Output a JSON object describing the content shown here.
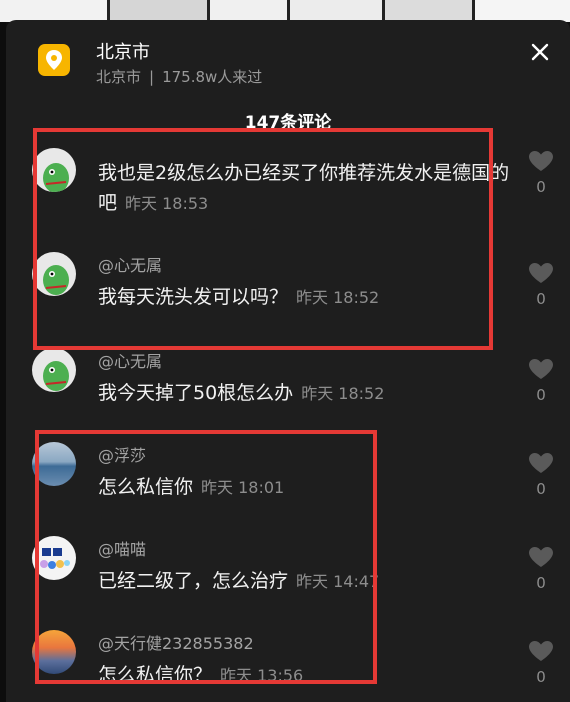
{
  "location": {
    "title": "北京市",
    "city": "北京市",
    "separator": "|",
    "visitors": "175.8w人来过",
    "icon": "location-pin-icon"
  },
  "comments_header": "147条评论",
  "comments": [
    {
      "author": "",
      "text": "我也是2级怎么办已经买了你推荐洗发水是德国的吧",
      "time": "昨天 18:53",
      "likes": "0"
    },
    {
      "author": "@心无属",
      "text": "我每天洗头发可以吗？",
      "time": "昨天 18:52",
      "likes": "0"
    },
    {
      "author": "@心无属",
      "text": "我今天掉了50根怎么办",
      "time": "昨天 18:52",
      "likes": "0"
    },
    {
      "author": "@浮莎",
      "text": "怎么私信你",
      "time": "昨天 18:01",
      "likes": "0"
    },
    {
      "author": "@喵喵",
      "text": "已经二级了，怎么治疗",
      "time": "昨天 14:47",
      "likes": "0"
    },
    {
      "author": "@天行健232855382",
      "text": "怎么私信你？",
      "time": "昨天 13:56",
      "likes": "0"
    }
  ],
  "colors": {
    "highlight": "#e53935",
    "panel": "#1e1e1e",
    "location_icon": "#f7b500"
  }
}
